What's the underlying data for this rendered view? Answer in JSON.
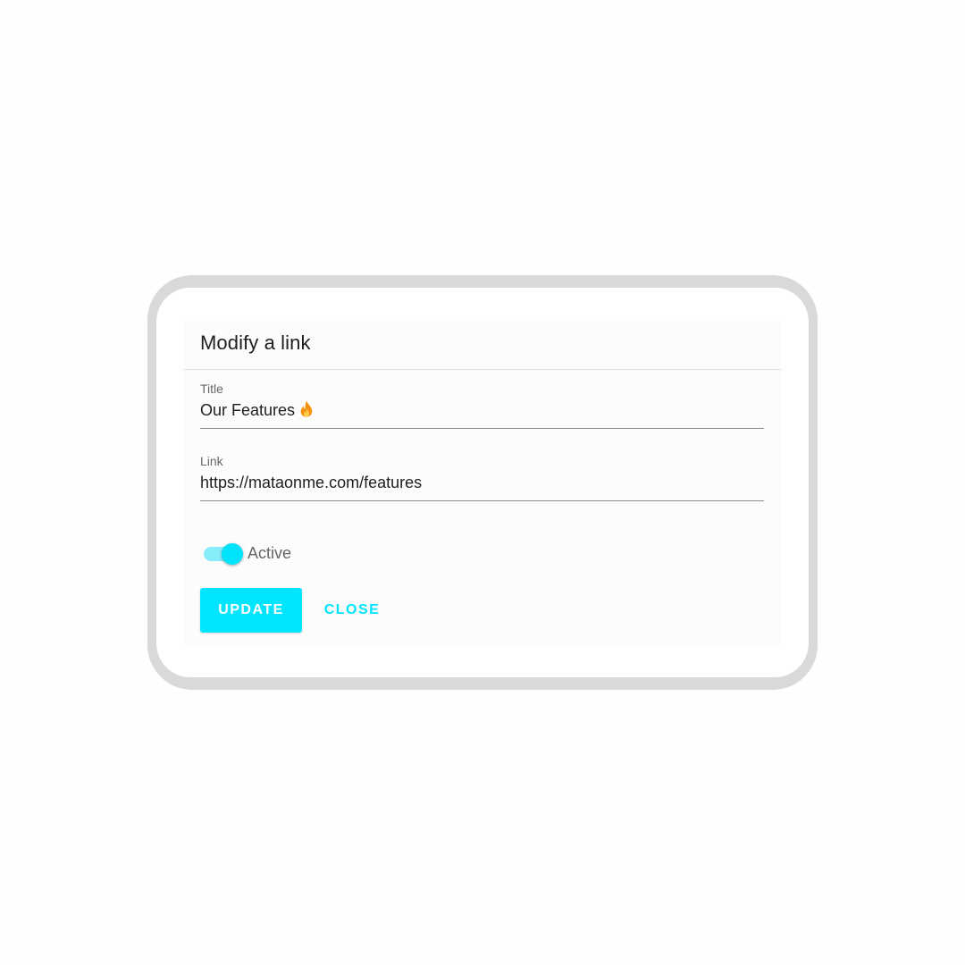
{
  "dialog": {
    "title": "Modify a link"
  },
  "fields": {
    "title": {
      "label": "Title",
      "value": "Our Features",
      "icon": "fire-icon"
    },
    "link": {
      "label": "Link",
      "value": "https://mataonme.com/features"
    }
  },
  "toggle": {
    "label": "Active",
    "checked": true
  },
  "actions": {
    "update_label": "UPDATE",
    "close_label": "CLOSE"
  },
  "colors": {
    "accent": "#00e5ff",
    "toggle_track": "#86eefb",
    "frame": "#d9d9d9"
  }
}
